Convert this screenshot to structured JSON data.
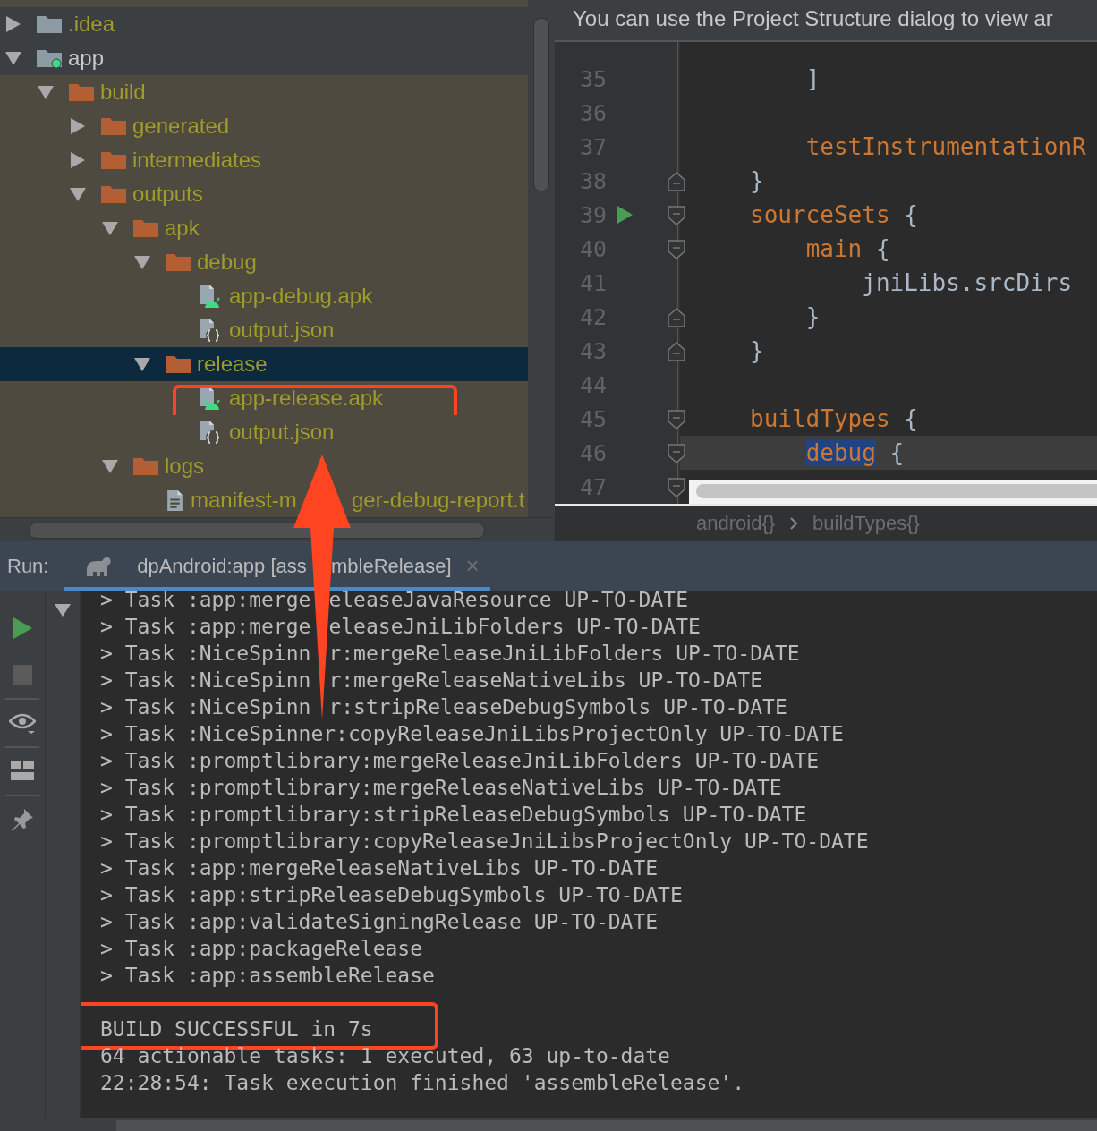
{
  "project_tree": {
    "items": [
      {
        "name": ".idea",
        "kind": "folder",
        "ignored": true,
        "expanded": false,
        "selected": false,
        "excluded": false,
        "highlighted": false
      },
      {
        "name": "app",
        "kind": "module",
        "ignored": false,
        "expanded": true,
        "selected": false,
        "excluded": false,
        "highlighted": false,
        "children": [
          {
            "name": "build",
            "kind": "folder",
            "ignored": true,
            "expanded": true,
            "selected": false,
            "excluded": true,
            "highlighted": false,
            "children": [
              {
                "name": "generated",
                "kind": "folder",
                "ignored": true,
                "expanded": false,
                "selected": false,
                "excluded": true,
                "highlighted": false
              },
              {
                "name": "intermediates",
                "kind": "folder",
                "ignored": true,
                "expanded": false,
                "selected": false,
                "excluded": true,
                "highlighted": false
              },
              {
                "name": "outputs",
                "kind": "folder",
                "ignored": true,
                "expanded": true,
                "selected": false,
                "excluded": true,
                "highlighted": false,
                "children": [
                  {
                    "name": "apk",
                    "kind": "folder",
                    "ignored": true,
                    "expanded": true,
                    "selected": false,
                    "excluded": true,
                    "highlighted": false,
                    "children": [
                      {
                        "name": "debug",
                        "kind": "folder",
                        "ignored": true,
                        "expanded": true,
                        "selected": false,
                        "excluded": true,
                        "highlighted": false,
                        "children": [
                          {
                            "name": "app-debug.apk",
                            "kind": "apk",
                            "ignored": true,
                            "selected": false,
                            "excluded": true,
                            "highlighted": false
                          },
                          {
                            "name": "output.json",
                            "kind": "json",
                            "ignored": true,
                            "selected": false,
                            "excluded": true,
                            "highlighted": false
                          }
                        ]
                      },
                      {
                        "name": "release",
                        "kind": "folder",
                        "ignored": true,
                        "expanded": true,
                        "selected": true,
                        "excluded": true,
                        "highlighted": false,
                        "children": [
                          {
                            "name": "app-release.apk",
                            "kind": "apk",
                            "ignored": true,
                            "selected": false,
                            "excluded": true,
                            "highlighted": true
                          },
                          {
                            "name": "output.json",
                            "kind": "json",
                            "ignored": true,
                            "selected": false,
                            "excluded": true,
                            "highlighted": false
                          }
                        ]
                      }
                    ]
                  },
                  {
                    "name": "logs",
                    "kind": "folder",
                    "ignored": true,
                    "expanded": true,
                    "selected": false,
                    "excluded": true,
                    "highlighted": false,
                    "children": [
                      {
                        "name_parts": [
                          "manifest-m",
                          "ger-debug-report.t"
                        ],
                        "kind": "text",
                        "ignored": true,
                        "selected": false,
                        "excluded": true,
                        "highlighted": false
                      }
                    ]
                  }
                ]
              }
            ]
          }
        ]
      }
    ]
  },
  "editor": {
    "notification": "You can use the Project Structure dialog to view ar",
    "lines": [
      {
        "number": "35",
        "fold_start": false,
        "fold_end": false,
        "run": false,
        "current": false,
        "tokens": [
          {
            "text": "    ]",
            "kind": "plain",
            "selected": false
          }
        ]
      },
      {
        "number": "36",
        "fold_start": false,
        "fold_end": false,
        "run": false,
        "current": false
      },
      {
        "number": "37",
        "fold_start": false,
        "fold_end": false,
        "run": false,
        "current": false,
        "tokens": [
          {
            "text": "    testInstrumentationR",
            "kind": "keyword",
            "selected": false
          }
        ]
      },
      {
        "number": "38",
        "fold_start": false,
        "fold_end": true,
        "run": false,
        "current": false,
        "tokens": [
          {
            "text": "}",
            "kind": "plain",
            "selected": false
          }
        ]
      },
      {
        "number": "39",
        "fold_start": true,
        "fold_end": false,
        "run": true,
        "current": false,
        "tokens": [
          {
            "text": "sourceSets",
            "kind": "keyword",
            "selected": false
          },
          {
            "text": " {",
            "kind": "plain",
            "selected": false
          }
        ]
      },
      {
        "number": "40",
        "fold_start": true,
        "fold_end": false,
        "run": false,
        "current": false,
        "tokens": [
          {
            "text": "    main",
            "kind": "keyword",
            "selected": false
          },
          {
            "text": " {",
            "kind": "plain",
            "selected": false
          }
        ]
      },
      {
        "number": "41",
        "fold_start": false,
        "fold_end": false,
        "run": false,
        "current": false,
        "tokens": [
          {
            "text": "        jniLibs.srcDirs",
            "kind": "plain",
            "selected": false
          }
        ]
      },
      {
        "number": "42",
        "fold_start": false,
        "fold_end": true,
        "run": false,
        "current": false,
        "tokens": [
          {
            "text": "    }",
            "kind": "plain",
            "selected": false
          }
        ]
      },
      {
        "number": "43",
        "fold_start": false,
        "fold_end": true,
        "run": false,
        "current": false,
        "tokens": [
          {
            "text": "}",
            "kind": "plain",
            "selected": false
          }
        ]
      },
      {
        "number": "44",
        "fold_start": false,
        "fold_end": false,
        "run": false,
        "current": false
      },
      {
        "number": "45",
        "fold_start": true,
        "fold_end": false,
        "run": false,
        "current": false,
        "tokens": [
          {
            "text": "buildTypes",
            "kind": "keyword",
            "selected": false
          },
          {
            "text": " {",
            "kind": "plain",
            "selected": false
          }
        ]
      },
      {
        "number": "46",
        "fold_start": true,
        "fold_end": false,
        "run": false,
        "current": true,
        "tokens": [
          {
            "text": "    debug",
            "kind": "keyword",
            "selected": true
          },
          {
            "text": " {",
            "kind": "plain",
            "selected": false
          }
        ]
      },
      {
        "number": "47",
        "fold_start": true,
        "fold_end": false,
        "run": false,
        "current": false
      }
    ],
    "breadcrumbs": [
      "android{}",
      "buildTypes{}"
    ]
  },
  "run_panel": {
    "label": "Run:",
    "tab": {
      "title_parts": [
        "dpAndroid:app [ass",
        "mbleRelease]"
      ],
      "selected": true,
      "close": "×"
    },
    "console_lines": [
      {
        "parts": [
          "> Task :app:merge",
          "eleaseJavaResource UP-TO-DATE"
        ],
        "highlighted": false
      },
      {
        "parts": [
          "> Task :app:merge",
          "eleaseJniLibFolders UP-TO-DATE"
        ],
        "highlighted": false
      },
      {
        "parts": [
          "> Task :NiceSpinn",
          "r:mergeReleaseJniLibFolders UP-TO-DATE"
        ],
        "highlighted": false
      },
      {
        "parts": [
          "> Task :NiceSpinn",
          "r:mergeReleaseNativeLibs UP-TO-DATE"
        ],
        "highlighted": false
      },
      {
        "parts": [
          "> Task :NiceSpinn",
          "r:stripReleaseDebugSymbols UP-TO-DATE"
        ],
        "highlighted": false
      },
      {
        "parts": [
          "> Task :NiceSpinner:copyReleaseJniLibsProjectOnly UP-TO-DATE"
        ],
        "highlighted": false
      },
      {
        "parts": [
          "> Task :promptlibrary:mergeReleaseJniLibFolders UP-TO-DATE"
        ],
        "highlighted": false
      },
      {
        "parts": [
          "> Task :promptlibrary:mergeReleaseNativeLibs UP-TO-DATE"
        ],
        "highlighted": false
      },
      {
        "parts": [
          "> Task :promptlibrary:stripReleaseDebugSymbols UP-TO-DATE"
        ],
        "highlighted": false
      },
      {
        "parts": [
          "> Task :promptlibrary:copyReleaseJniLibsProjectOnly UP-TO-DATE"
        ],
        "highlighted": false
      },
      {
        "parts": [
          "> Task :app:mergeReleaseNativeLibs UP-TO-DATE"
        ],
        "highlighted": false
      },
      {
        "parts": [
          "> Task :app:stripReleaseDebugSymbols UP-TO-DATE"
        ],
        "highlighted": false
      },
      {
        "parts": [
          "> Task :app:validateSigningRelease UP-TO-DATE"
        ],
        "highlighted": false
      },
      {
        "parts": [
          "> Task :app:packageRelease"
        ],
        "highlighted": false
      },
      {
        "parts": [
          "> Task :app:assembleRelease"
        ],
        "highlighted": false
      }
    ],
    "summary_lines": [
      {
        "parts": [
          "BUILD SUCCESSFUL in 7s"
        ],
        "highlighted": true
      },
      {
        "parts": [
          "64 actionable tasks: 1 executed, 63 up-to-date"
        ],
        "highlighted": false
      },
      {
        "parts": [
          "22:28:54: Task execution finished 'assembleRelease'."
        ],
        "highlighted": false
      }
    ]
  },
  "annotations": [
    {
      "kind": "arrow"
    }
  ]
}
